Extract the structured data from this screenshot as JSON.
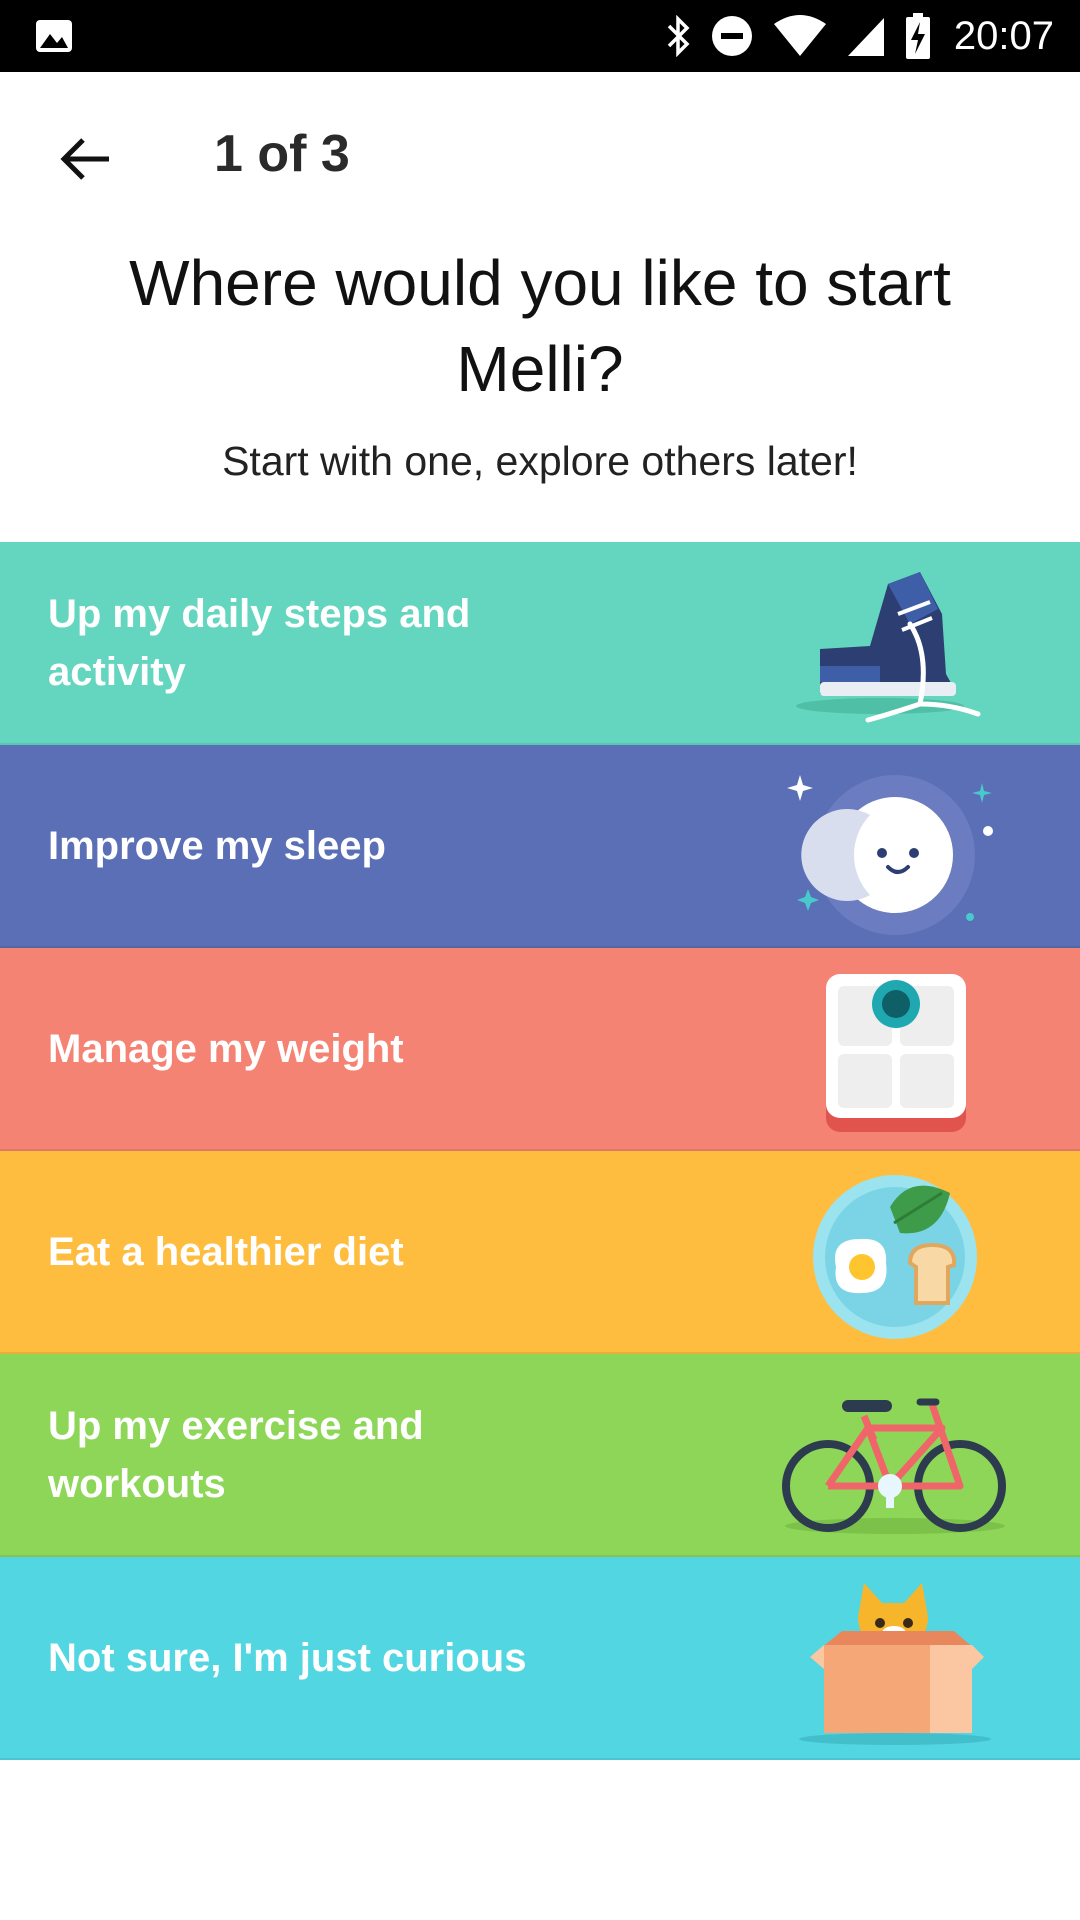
{
  "status_bar": {
    "time": "20:07"
  },
  "header": {
    "page_indicator": "1 of 3"
  },
  "prompt": {
    "title": "Where would you like to start Melli?",
    "subtitle": "Start with one, explore others later!"
  },
  "options": [
    {
      "label": "Up my daily steps and activity",
      "color": "#64D6BF",
      "icon": "sneaker-icon"
    },
    {
      "label": "Improve my sleep",
      "color": "#5A6FB5",
      "icon": "moon-icon"
    },
    {
      "label": "Manage my weight",
      "color": "#F58374",
      "icon": "scale-icon"
    },
    {
      "label": "Eat a healthier diet",
      "color": "#FFBD3F",
      "icon": "plate-icon"
    },
    {
      "label": "Up my exercise and workouts",
      "color": "#8ED657",
      "icon": "bicycle-icon"
    },
    {
      "label": "Not sure, I'm just curious",
      "color": "#52D6E2",
      "icon": "cat-box-icon"
    }
  ]
}
